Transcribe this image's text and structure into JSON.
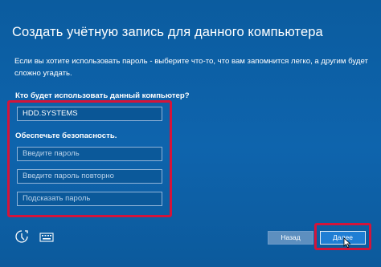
{
  "page": {
    "title": "Создать учётную запись для данного компьютера",
    "description": "Если вы хотите использовать пароль - выберите что-то, что вам запомнится легко, а другим будет сложно угадать."
  },
  "form": {
    "who_label": "Кто будет использовать данный компьютер?",
    "username_value": "HDD.SYSTEMS",
    "security_label": "Обеспечьте безопасность.",
    "password_placeholder": "Введите пароль",
    "password_repeat_placeholder": "Введите пароль повторно",
    "hint_placeholder": "Подсказать пароль"
  },
  "footer": {
    "back_label": "Назад",
    "next_label": "Далее",
    "icons": [
      "accessibility-icon",
      "keyboard-icon"
    ]
  },
  "colors": {
    "background": "#0e64ad",
    "highlight": "#d4143a",
    "primary_button": "#1f7ed4"
  }
}
